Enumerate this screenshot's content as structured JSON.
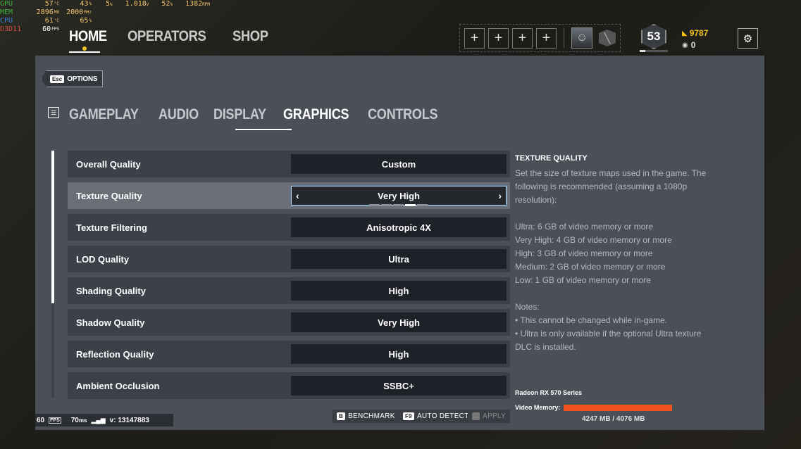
{
  "osd": {
    "rows": [
      {
        "name": "GPU",
        "v1": "57",
        "u1": "°C",
        "v2": "43",
        "u2": "%"
      },
      {
        "name": "MEM",
        "v1": "2896",
        "u1": "MB",
        "v2": "2000",
        "u2": "MHz"
      },
      {
        "name": "CPU",
        "v1": "61",
        "u1": "°C",
        "v2": "65",
        "u2": "%"
      },
      {
        "name": "D3D11",
        "v1": "60",
        "u1": "FPS",
        "v2": "",
        "u2": ""
      }
    ],
    "extra": [
      {
        "v": "5",
        "u": "%"
      },
      {
        "v": "1.018",
        "u": "V"
      },
      {
        "v": "52",
        "u": "%"
      },
      {
        "v": "1382",
        "u": "RPM"
      }
    ]
  },
  "nav": {
    "home": "HOME",
    "operators": "OPERATORS",
    "shop": "SHOP"
  },
  "squad": {
    "slot_symbol": "+"
  },
  "level": {
    "value": "53",
    "progress": 0.2
  },
  "currency": {
    "renown": "9787",
    "credits": "0"
  },
  "options_button": {
    "key": "Esc",
    "label": "OPTIONS"
  },
  "tabs": [
    "GAMEPLAY",
    "AUDIO",
    "DISPLAY",
    "GRAPHICS",
    "CONTROLS"
  ],
  "settings": [
    {
      "label": "Overall Quality",
      "value": "Custom"
    },
    {
      "label": "Texture Quality",
      "value": "Very High"
    },
    {
      "label": "Texture Filtering",
      "value": "Anisotropic 4X"
    },
    {
      "label": "LOD Quality",
      "value": "Ultra"
    },
    {
      "label": "Shading Quality",
      "value": "High"
    },
    {
      "label": "Shadow Quality",
      "value": "Very High"
    },
    {
      "label": "Reflection Quality",
      "value": "High"
    },
    {
      "label": "Ambient Occlusion",
      "value": "SSBC+"
    }
  ],
  "selected_level": {
    "index": 3,
    "total": 5
  },
  "description": {
    "title": "TEXTURE QUALITY",
    "intro_lines": [
      "Set the size of texture maps used in the game. The",
      "following is recommended (assuming a 1080p",
      "resolution):"
    ],
    "recommendations": [
      "Ultra: 6 GB of video memory or more",
      "Very High: 4 GB of video memory or more",
      "High: 3 GB of video memory or more",
      "Medium: 2 GB of video memory or more",
      "Low: 1 GB of video memory or more"
    ],
    "notes_title": "Notes:",
    "notes_lines": [
      "• This cannot be changed while in-game.",
      "• Ultra is only available if the optional Ultra texture",
      "DLC is installed."
    ]
  },
  "gpu": {
    "name": "Radeon RX 570 Series",
    "vram_label": "Video Memory:",
    "vram_usage": "4247 MB / 4076 MB",
    "vram_color": "#f0501c"
  },
  "actions": {
    "benchmark": {
      "key": "B",
      "label": "BENCHMARK"
    },
    "auto_detect": {
      "key": "F9",
      "label": "AUTO DETECT"
    },
    "apply": {
      "key": "",
      "label": "APPLY"
    }
  },
  "status": {
    "fps": "60",
    "fps_unit": "FPS",
    "ping": "70",
    "ping_unit": "ms",
    "version": "v: 13147883"
  }
}
